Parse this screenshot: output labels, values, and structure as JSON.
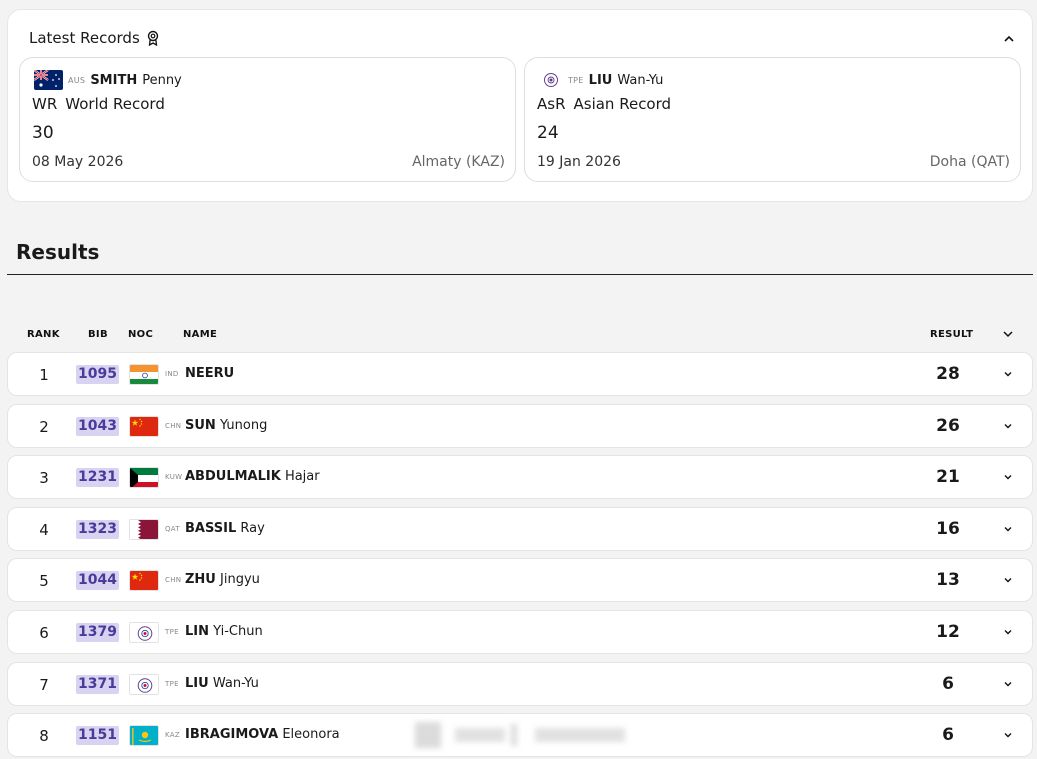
{
  "latest_records": {
    "title": "Latest Records",
    "cards": [
      {
        "noc": "AUS",
        "last_name": "SMITH",
        "first_name": "Penny",
        "flag": "australia-flag",
        "record_code": "WR",
        "record_name": "World Record",
        "value": "30",
        "date": "08 May 2026",
        "place": "Almaty (KAZ)"
      },
      {
        "noc": "TPE",
        "last_name": "LIU",
        "first_name": "Wan-Yu",
        "flag": "chinese-taipei-flag",
        "record_code": "AsR",
        "record_name": "Asian Record",
        "value": "24",
        "date": "19 Jan 2026",
        "place": "Doha (QAT)"
      }
    ]
  },
  "results": {
    "title": "Results",
    "headers": {
      "rank": "RANK",
      "bib": "BIB",
      "noc": "NOC",
      "name": "NAME",
      "result": "RESULT"
    },
    "rows": [
      {
        "rank": "1",
        "bib": "1095",
        "noc": "IND",
        "last": "NEERU",
        "first": "",
        "result": "28",
        "flag": "india-flag"
      },
      {
        "rank": "2",
        "bib": "1043",
        "noc": "CHN",
        "last": "SUN",
        "first": "Yunong",
        "result": "26",
        "flag": "china-flag"
      },
      {
        "rank": "3",
        "bib": "1231",
        "noc": "KUW",
        "last": "ABDULMALIK",
        "first": "Hajar",
        "result": "21",
        "flag": "kuwait-flag"
      },
      {
        "rank": "4",
        "bib": "1323",
        "noc": "QAT",
        "last": "BASSIL",
        "first": "Ray",
        "result": "16",
        "flag": "qatar-flag"
      },
      {
        "rank": "5",
        "bib": "1044",
        "noc": "CHN",
        "last": "ZHU",
        "first": "Jingyu",
        "result": "13",
        "flag": "china-flag"
      },
      {
        "rank": "6",
        "bib": "1379",
        "noc": "TPE",
        "last": "LIN",
        "first": "Yi-Chun",
        "result": "12",
        "flag": "chinese-taipei-flag"
      },
      {
        "rank": "7",
        "bib": "1371",
        "noc": "TPE",
        "last": "LIU",
        "first": "Wan-Yu",
        "result": "6",
        "flag": "chinese-taipei-flag"
      },
      {
        "rank": "8",
        "bib": "1151",
        "noc": "KAZ",
        "last": "IBRAGIMOVA",
        "first": "Eleonora",
        "result": "6",
        "flag": "kazakhstan-flag"
      }
    ]
  },
  "colors": {
    "bib_bg": "#d9d3f2",
    "bib_text": "#4a3a9a",
    "page_bg": "#f3f3f3"
  }
}
